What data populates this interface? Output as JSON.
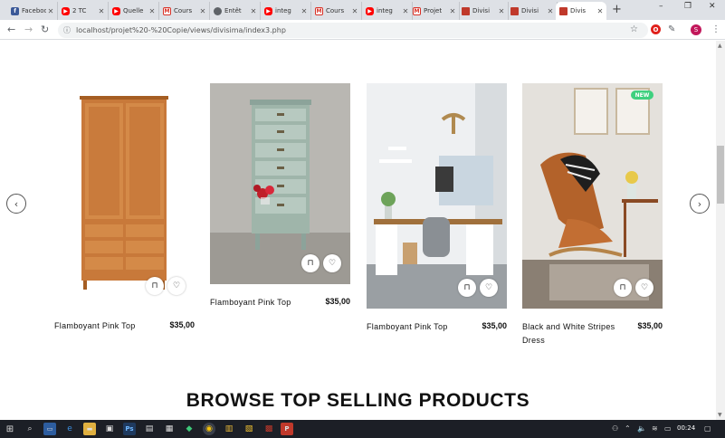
{
  "browser": {
    "tabs": [
      {
        "title": "Facebook",
        "favicon": "facebook-icon",
        "active": false
      },
      {
        "title": "2 TC",
        "favicon": "youtube-icon",
        "active": false
      },
      {
        "title": "Quelle",
        "favicon": "youtube-icon",
        "active": false
      },
      {
        "title": "Cours",
        "favicon": "gmail-icon",
        "active": false
      },
      {
        "title": "Entêt",
        "favicon": "globe-icon",
        "active": false
      },
      {
        "title": "integ",
        "favicon": "youtube-icon",
        "active": false
      },
      {
        "title": "Cours",
        "favicon": "gmail-icon",
        "active": false
      },
      {
        "title": "integ",
        "favicon": "youtube-icon",
        "active": false
      },
      {
        "title": "Projet",
        "favicon": "gmail-icon",
        "active": false
      },
      {
        "title": "Divisi",
        "favicon": "divisima-icon",
        "active": false
      },
      {
        "title": "Divisi",
        "favicon": "divisima-icon",
        "active": false
      },
      {
        "title": "Divis",
        "favicon": "divisima-icon",
        "active": true
      }
    ],
    "new_tab": "+",
    "url": "localhost/projet%20-%20Copie/views/divisima/index3.php",
    "profile_initial": "S",
    "opera_label": "O"
  },
  "page": {
    "products": [
      {
        "name": "Flamboyant Pink Top",
        "price": "$35,00",
        "image": "wooden-wardrobe"
      },
      {
        "name": "Flamboyant Pink Top",
        "price": "$35,00",
        "image": "blue-chest-of-drawers"
      },
      {
        "name": "Flamboyant Pink Top",
        "price": "$35,00",
        "image": "white-desk"
      },
      {
        "name": "Black and White Stripes Dress",
        "price": "$35,00",
        "image": "leather-lounge-chair",
        "badge": "NEW"
      }
    ],
    "prev_arrow": "‹",
    "next_arrow": "›",
    "section_title": "BROWSE TOP SELLING PRODUCTS"
  },
  "taskbar": {
    "clock": "00:24"
  },
  "colors": {
    "badge": "#3fd07f",
    "wardrobe": "#c8793a",
    "drawers": "#9fb5aa"
  }
}
